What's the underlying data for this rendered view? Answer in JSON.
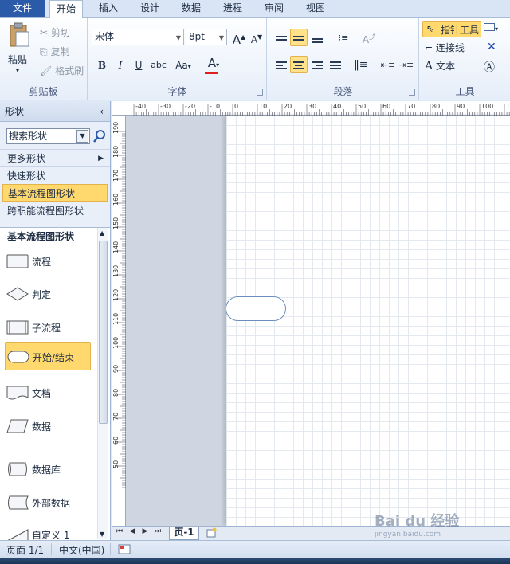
{
  "tabs": {
    "file": "文件",
    "items": [
      "开始",
      "插入",
      "设计",
      "数据",
      "进程",
      "审阅",
      "视图"
    ]
  },
  "clipboard": {
    "paste": "粘贴",
    "cut": "剪切",
    "copy": "复制",
    "format_painter": "格式刷",
    "label": "剪贴板"
  },
  "font": {
    "name": "宋体",
    "size": "8pt",
    "bold": "B",
    "italic": "I",
    "underline": "U",
    "strike": "abc",
    "case": "Aa",
    "color_letter": "A",
    "grow": "A",
    "shrink": "A",
    "label": "字体",
    "color": "#e02020"
  },
  "paragraph": {
    "label": "段落"
  },
  "tools": {
    "pointer": "指针工具",
    "connector": "连接线",
    "text": "文本",
    "label": "工具"
  },
  "shapes_panel": {
    "title": "形状",
    "search_placeholder": "搜索形状",
    "more": "更多形状",
    "quick": "快速形状",
    "basic_flowchart": "基本流程图形状",
    "cross_functional": "跨职能流程图形状",
    "stencil_title": "基本流程图形状",
    "items": [
      "流程",
      "判定",
      "子流程",
      "开始/结束",
      "文档",
      "数据",
      "数据库",
      "外部数据",
      "自定义 1"
    ]
  },
  "ruler": {
    "top_labels": [
      "-40",
      "-30",
      "-20",
      "-10",
      "0",
      "10",
      "20",
      "30",
      "40",
      "50",
      "60",
      "70",
      "80",
      "90",
      "100",
      "110"
    ],
    "left_labels": [
      "190",
      "180",
      "170",
      "160",
      "150",
      "140",
      "130",
      "120",
      "110",
      "100",
      "90",
      "80",
      "70",
      "60",
      "50"
    ]
  },
  "page_tabs": {
    "current": "页-1"
  },
  "status": {
    "page": "页面 1/1",
    "language": "中文(中国)"
  },
  "watermark": {
    "brand": "Bai du 经验",
    "url": "jingyan.baidu.com"
  }
}
